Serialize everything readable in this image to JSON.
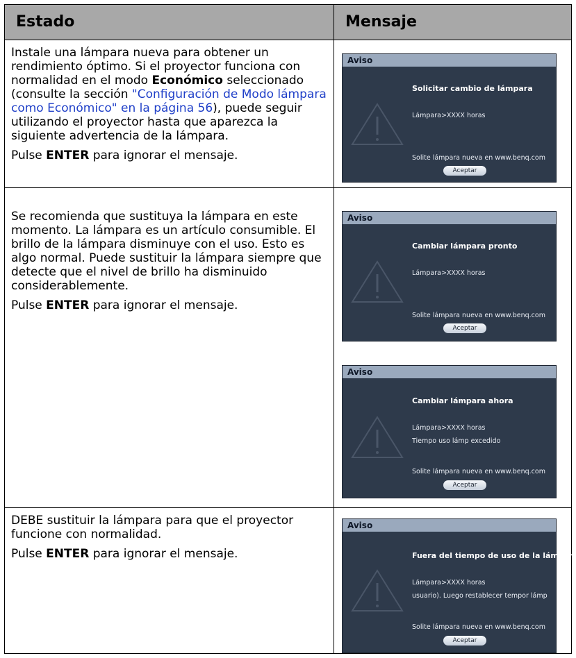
{
  "table": {
    "headers": [
      "Estado",
      "Mensaje"
    ],
    "rows": [
      {
        "text": {
          "p1_a": "Instale una lámpara nueva para obtener un rendimiento óptimo. Si el proyector funciona con normalidad en el modo ",
          "p1_bold": "Económico",
          "p1_b": " seleccionado (consulte la sección ",
          "p1_link": "\"Configuración de Modo lámpara como Económico\" en la página 56",
          "p1_c": "), puede seguir utilizando el proyector hasta que aparezca la siguiente advertencia de la lámpara.",
          "p2_a": "Pulse ",
          "p2_bold": "ENTER",
          "p2_b": " para ignorar el mensaje."
        }
      },
      {
        "text": {
          "p1": "Se recomienda que sustituya la lámpara en este momento. La lámpara es un artículo consumible. El brillo de la lámpara disminuye con el uso. Esto es algo normal. Puede sustituir la lámpara siempre que detecte que el nivel de brillo ha disminuido considerablemente.",
          "p2_a": "Pulse ",
          "p2_bold": "ENTER",
          "p2_b": " para ignorar el mensaje."
        }
      },
      {
        "text": {
          "p1": "DEBE sustituir la lámpara para que el proyector funcione con normalidad.",
          "p2_a": "Pulse ",
          "p2_bold": "ENTER",
          "p2_b": " para ignorar el mensaje."
        }
      }
    ]
  },
  "dialogs": [
    {
      "title": "Aviso",
      "heading": "Solicitar cambio de lámpara",
      "line1": "Lámpara>XXXX horas",
      "line2": "",
      "footer": "Solite lámpara nueva en www.benq.com",
      "button": "Aceptar"
    },
    {
      "title": "Aviso",
      "heading": "Cambiar lámpara pronto",
      "line1": "Lámpara>XXXX horas",
      "line2": "",
      "footer": "Solite lámpara nueva en www.benq.com",
      "button": "Aceptar"
    },
    {
      "title": "Aviso",
      "heading": "Cambiar lámpara ahora",
      "line1": "Lámpara>XXXX horas",
      "line2": "Tiempo uso lámp excedido",
      "footer": "Solite lámpara nueva en www.benq.com",
      "button": "Aceptar"
    },
    {
      "title": "Aviso",
      "heading": "Fuera del tiempo de uso de la lámpara",
      "line1": "Lámpara>XXXX horas",
      "line2": "usuario). Luego restablecer tempor lámp",
      "footer": "Solite lámpara nueva en www.benq.com",
      "button": "Aceptar"
    }
  ],
  "icons": {
    "warning": "warning-triangle-icon"
  },
  "colors": {
    "header_bg": "#a8a8a8",
    "link": "#1f3fc8",
    "dialog_bg": "#2e3a4b",
    "dialog_title_bg": "#9aa9bd"
  }
}
